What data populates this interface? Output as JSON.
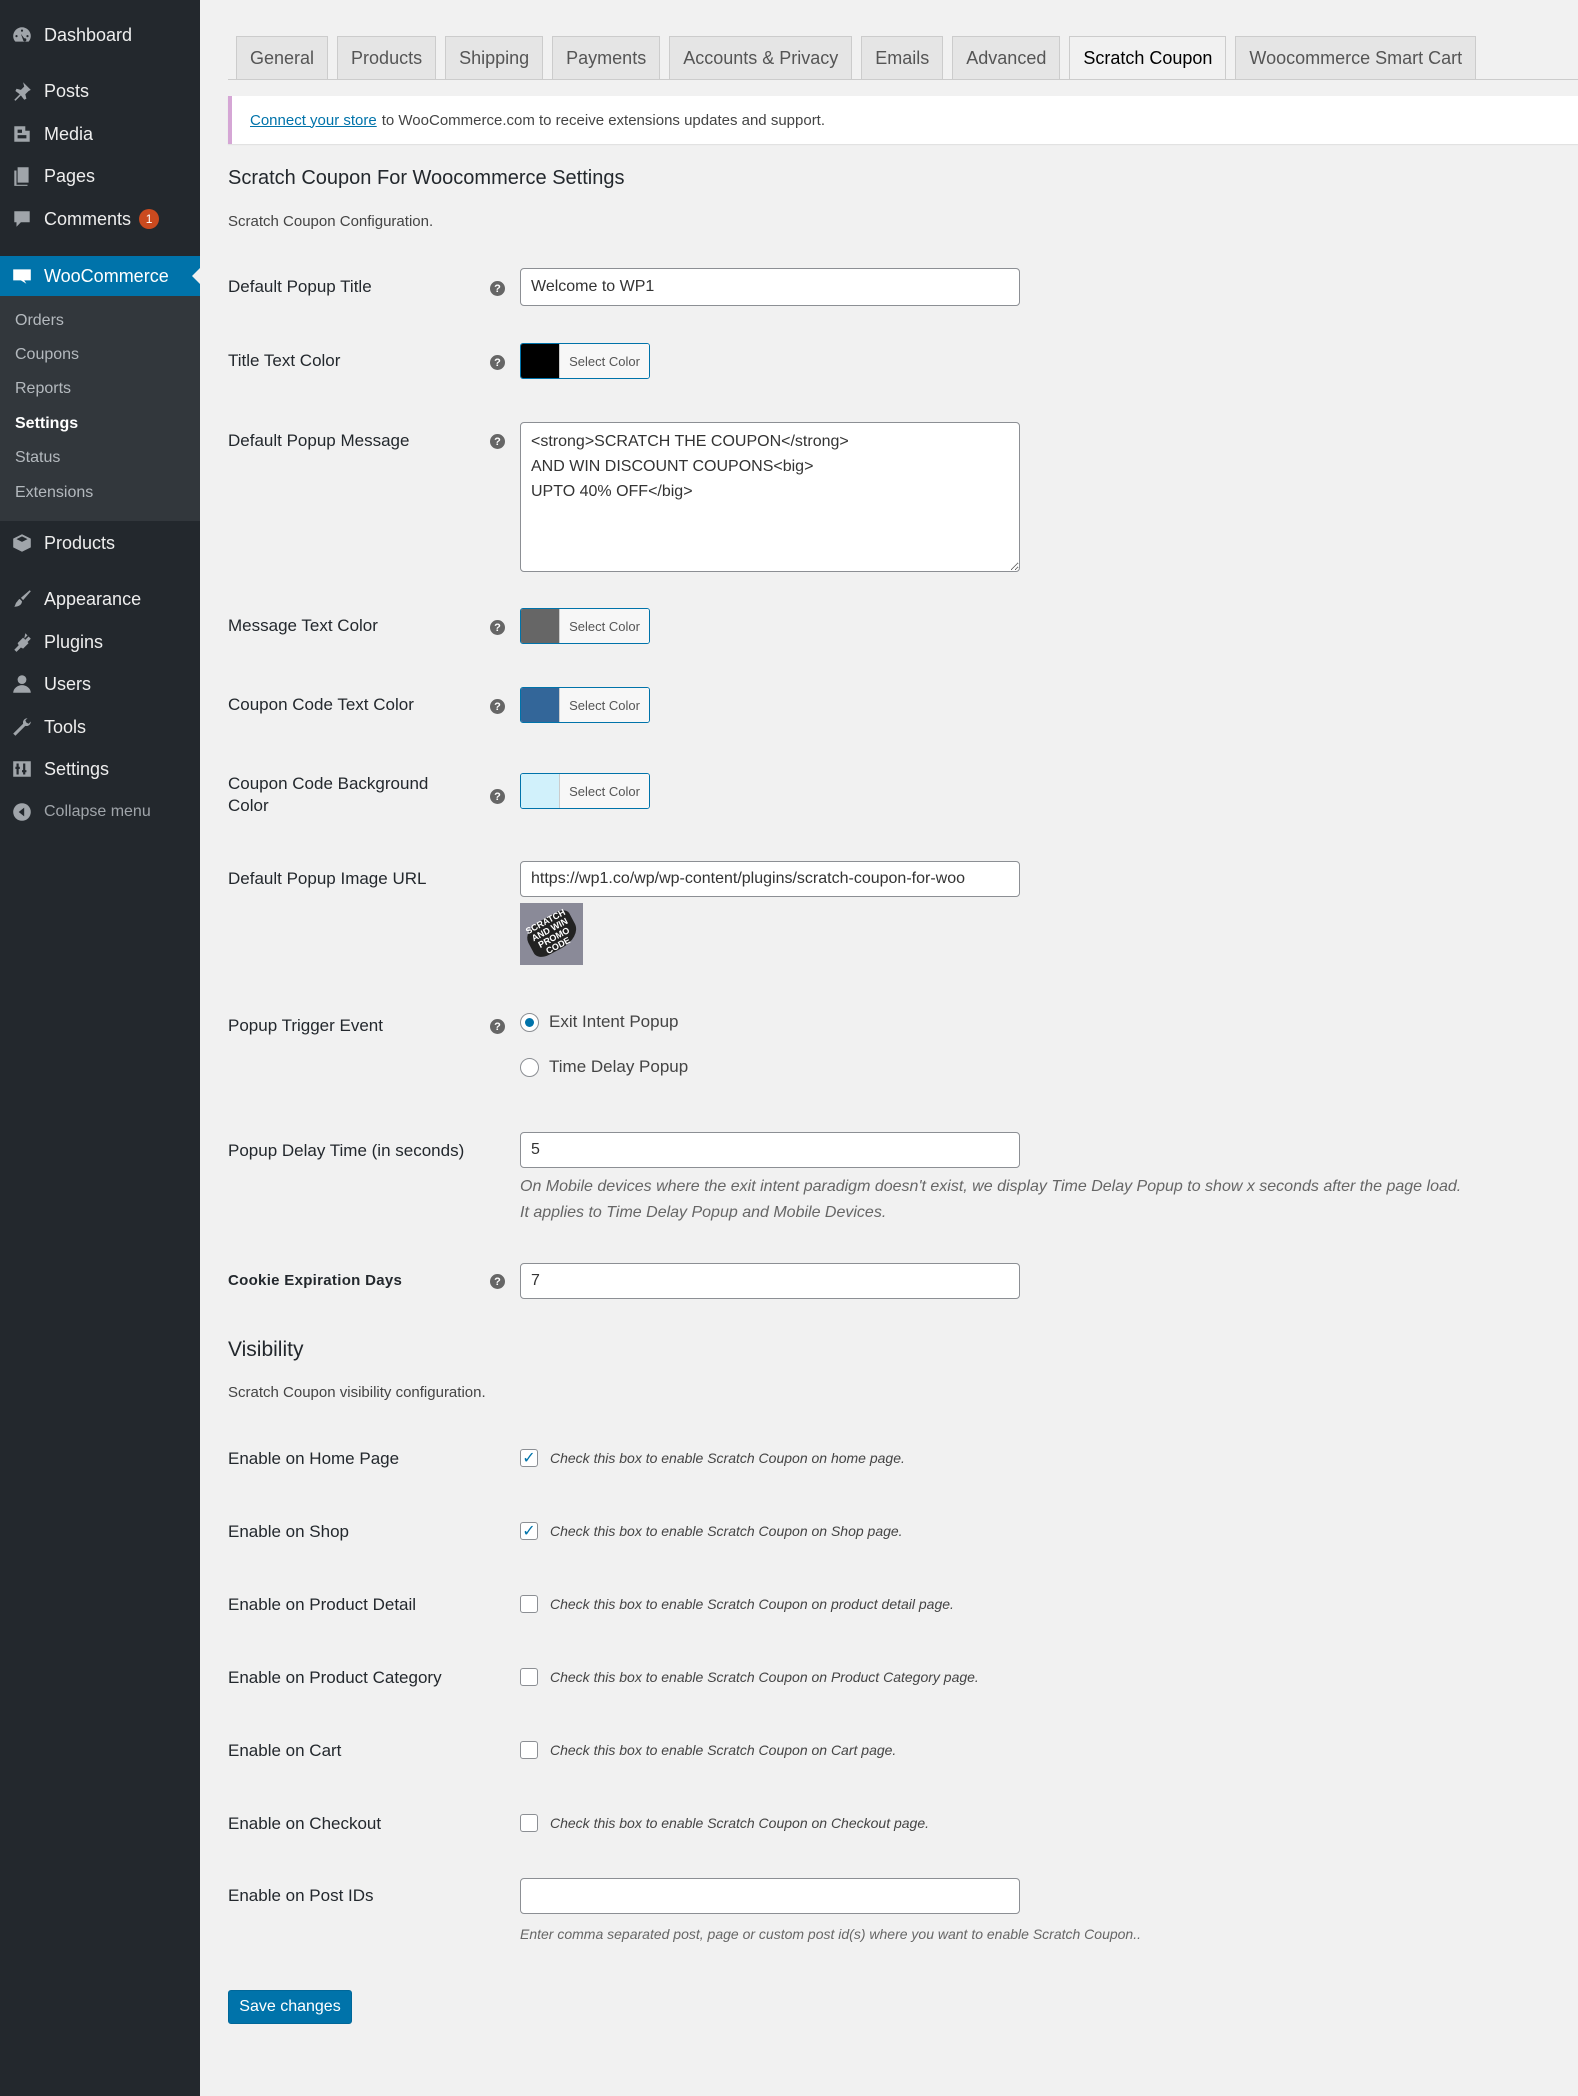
{
  "sidebar": {
    "dashboard": "Dashboard",
    "posts": "Posts",
    "media": "Media",
    "pages": "Pages",
    "comments": "Comments",
    "comments_count": "1",
    "woocommerce": "WooCommerce",
    "sub": {
      "orders": "Orders",
      "coupons": "Coupons",
      "reports": "Reports",
      "settings": "Settings",
      "status": "Status",
      "extensions": "Extensions"
    },
    "products": "Products",
    "appearance": "Appearance",
    "plugins": "Plugins",
    "users": "Users",
    "tools": "Tools",
    "settings": "Settings",
    "collapse": "Collapse menu"
  },
  "tabs": [
    "General",
    "Products",
    "Shipping",
    "Payments",
    "Accounts & Privacy",
    "Emails",
    "Advanced",
    "Scratch Coupon",
    "Woocommerce Smart Cart"
  ],
  "notice": {
    "link": "Connect your store",
    "text": "to WooCommerce.com to receive extensions updates and support."
  },
  "section1": {
    "title": "Scratch Coupon For Woocommerce Settings",
    "desc": "Scratch Coupon Configuration."
  },
  "fields": {
    "popup_title_label": "Default Popup Title",
    "popup_title_value": "Welcome to WP1",
    "title_color_label": "Title Text Color",
    "select_color": "Select Color",
    "popup_message_label": "Default Popup Message",
    "popup_message_value": "<strong>SCRATCH THE COUPON</strong>\nAND WIN DISCOUNT COUPONS<big>\nUPTO 40% OFF</big>",
    "message_color_label": "Message Text Color",
    "coupon_text_color_label": "Coupon Code Text Color",
    "coupon_bg_color_label": "Coupon Code Background Color",
    "image_url_label": "Default Popup Image URL",
    "image_url_value": "https://wp1.co/wp/wp-content/plugins/scratch-coupon-for-woo",
    "trigger_label": "Popup Trigger Event",
    "trigger_exit": "Exit Intent Popup",
    "trigger_delay": "Time Delay Popup",
    "delay_label": "Popup Delay Time (in seconds)",
    "delay_value": "5",
    "delay_note1": "On Mobile devices where the exit intent paradigm doesn't exist, we display Time Delay Popup to show x seconds after the page load.",
    "delay_note2": "It applies to Time Delay Popup and Mobile Devices.",
    "cookie_label": "Cookie Expiration Days",
    "cookie_value": "7"
  },
  "colors": {
    "title": "#000000",
    "message": "#666666",
    "coupon_text": "#336699",
    "coupon_bg": "#d1f1fb"
  },
  "section2": {
    "title": "Visibility",
    "desc": "Scratch Coupon visibility configuration."
  },
  "visibility": [
    {
      "label": "Enable on Home Page",
      "text": "Check this box to enable Scratch Coupon on home page.",
      "checked": true
    },
    {
      "label": "Enable on Shop",
      "text": "Check this box to enable Scratch Coupon on Shop page.",
      "checked": true
    },
    {
      "label": "Enable on Product Detail",
      "text": "Check this box to enable Scratch Coupon on product detail page.",
      "checked": false
    },
    {
      "label": "Enable on Product Category",
      "text": "Check this box to enable Scratch Coupon on Product Category page.",
      "checked": false
    },
    {
      "label": "Enable on Cart",
      "text": "Check this box to enable Scratch Coupon on Cart page.",
      "checked": false
    },
    {
      "label": "Enable on Checkout",
      "text": "Check this box to enable Scratch Coupon on Checkout page.",
      "checked": false
    }
  ],
  "post_ids": {
    "label": "Enable on Post IDs",
    "value": "",
    "note": "Enter comma separated post, page or custom post id(s) where you want to enable Scratch Coupon.."
  },
  "save_label": "Save changes",
  "thumb_text": "SCRATCH AND WIN PROMO CODE"
}
